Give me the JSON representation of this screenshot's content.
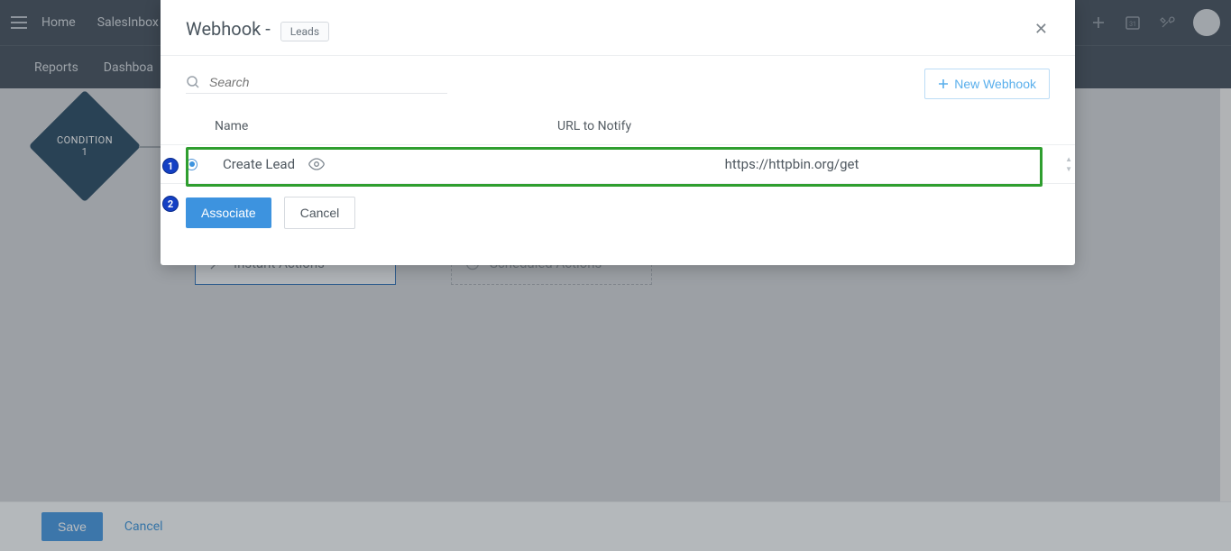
{
  "topnav": {
    "items": [
      "Home",
      "SalesInbox"
    ],
    "right_icons": [
      "plus-icon",
      "calendar-icon",
      "tools-icon"
    ]
  },
  "secondnav": {
    "items": [
      "Reports",
      "Dashboa"
    ]
  },
  "condition_node": {
    "label": "CONDITION",
    "number": "1"
  },
  "actions": {
    "instant": "Instant Actions",
    "scheduled": "Scheduled Actions"
  },
  "bottombar": {
    "save": "Save",
    "cancel": "Cancel"
  },
  "modal": {
    "title_prefix": "Webhook - ",
    "module_pill": "Leads",
    "search_placeholder": "Search",
    "new_webhook": "New Webhook",
    "columns": {
      "name": "Name",
      "url": "URL to Notify"
    },
    "rows": [
      {
        "name": "Create Lead",
        "url": "https://httpbin.org/get",
        "selected": true
      }
    ],
    "footer": {
      "associate": "Associate",
      "cancel": "Cancel"
    },
    "step_badges": {
      "one": "1",
      "two": "2"
    }
  }
}
